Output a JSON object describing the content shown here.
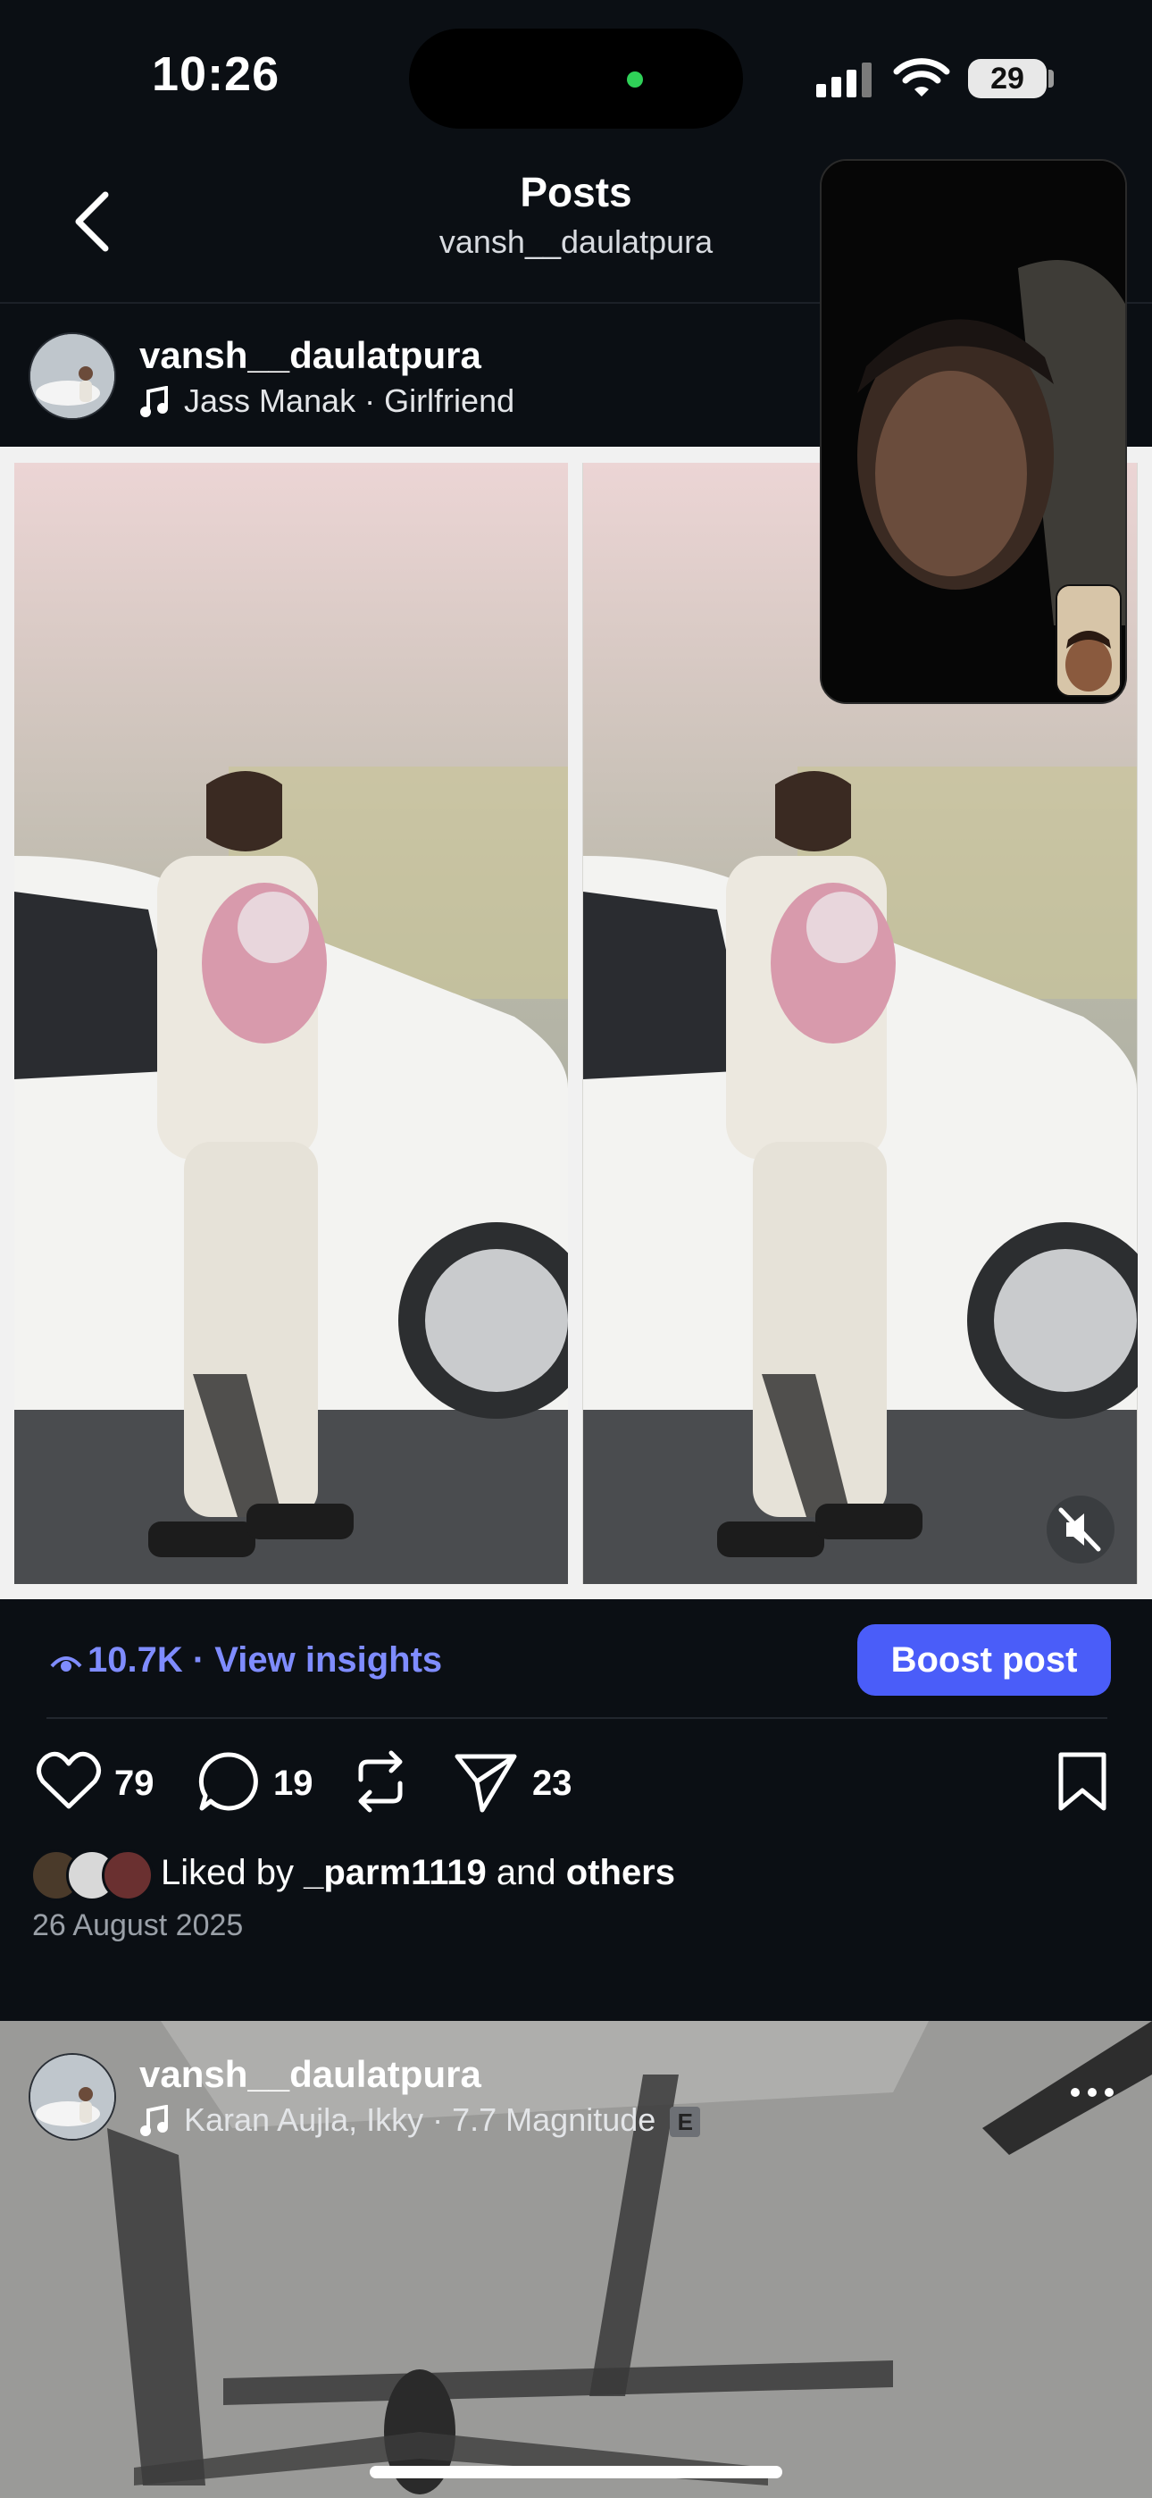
{
  "status": {
    "time": "10:26",
    "battery": "29"
  },
  "header": {
    "title": "Posts",
    "subtitle": "vansh__daulatpura"
  },
  "post1": {
    "username": "vansh__daulatpura",
    "song": "Jass Manak · Girlfriend",
    "views": "10.7K",
    "views_link": "View insights",
    "boost_label": "Boost post",
    "likes_count": "79",
    "comments_count": "19",
    "shares_count": "23",
    "liked_by_prefix": "Liked by",
    "liked_by_user": "_parm1119",
    "liked_by_and": "and",
    "liked_by_others": "others",
    "date": "26 August 2025"
  },
  "post2": {
    "username": "vansh__daulatpura",
    "song": "Karan Aujla, Ikky · 7.7 Magnitude",
    "explicit": "E"
  },
  "colors": {
    "accent": "#4a5df9",
    "link": "#7f8cff",
    "bg": "#0b0f14"
  }
}
